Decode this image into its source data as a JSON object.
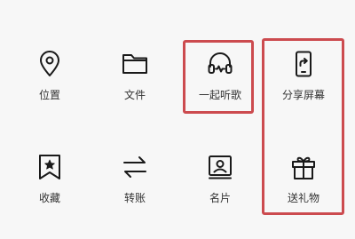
{
  "panel": {
    "items": [
      {
        "label": "位置",
        "icon": "location-pin-icon"
      },
      {
        "label": "文件",
        "icon": "folder-icon"
      },
      {
        "label": "一起听歌",
        "icon": "headphones-icon"
      },
      {
        "label": "分享屏幕",
        "icon": "share-screen-icon"
      },
      {
        "label": "收藏",
        "icon": "bookmark-star-icon"
      },
      {
        "label": "转账",
        "icon": "transfer-arrows-icon"
      },
      {
        "label": "名片",
        "icon": "contact-card-icon"
      },
      {
        "label": "送礼物",
        "icon": "gift-icon"
      }
    ]
  },
  "highlight": {
    "color": "#cc4b4f"
  },
  "colors": {
    "background": "#f7f7f7",
    "icon": "#1a1a1a",
    "label": "#333333"
  }
}
